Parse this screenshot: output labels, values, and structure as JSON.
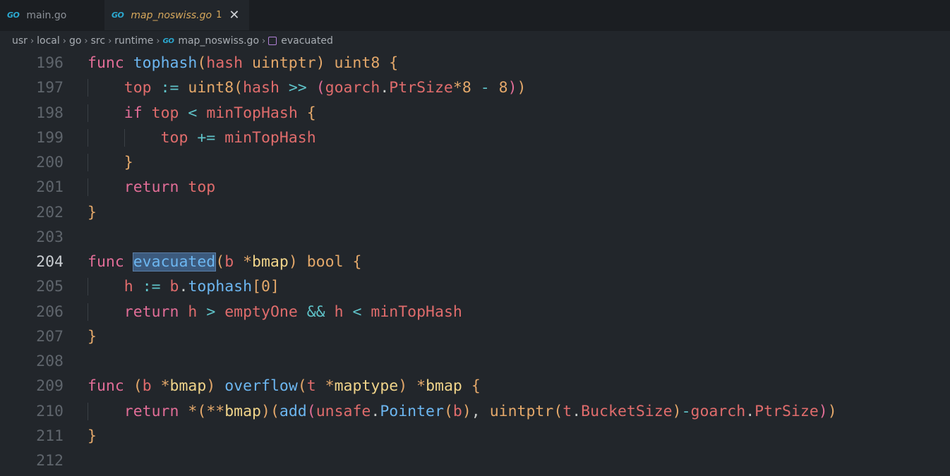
{
  "tabs": [
    {
      "label": "main.go",
      "active": false
    },
    {
      "label": "map_noswiss.go",
      "active": true,
      "badge": "1",
      "close": "✕"
    }
  ],
  "icons": {
    "go_logo": "GO"
  },
  "breadcrumb": [
    "usr",
    "local",
    "go",
    "src",
    "runtime",
    "map_noswiss.go",
    "evacuated"
  ],
  "line_numbers": [
    "196",
    "197",
    "198",
    "199",
    "200",
    "201",
    "202",
    "203",
    "204",
    "205",
    "206",
    "207",
    "208",
    "209",
    "210",
    "211",
    "212"
  ],
  "current_line": "204",
  "code_lines": [
    "func tophash(hash uintptr) uint8 {",
    "    top := uint8(hash >> (goarch.PtrSize*8 - 8))",
    "    if top < minTopHash {",
    "        top += minTopHash",
    "    }",
    "    return top",
    "}",
    "",
    "func evacuated(b *bmap) bool {",
    "    h := b.tophash[0]",
    "    return h > emptyOne && h < minTopHash",
    "}",
    "",
    "func (b *bmap) overflow(t *maptype) *bmap {",
    "    return *(**bmap)(add(unsafe.Pointer(b), uintptr(t.BucketSize)-goarch.PtrSize))",
    "}",
    ""
  ],
  "colors": {
    "background": "#22262b",
    "keyword": "#e16d97",
    "function": "#6cb6f0",
    "type": "#e4a86a",
    "variable": "#e06c6c"
  }
}
